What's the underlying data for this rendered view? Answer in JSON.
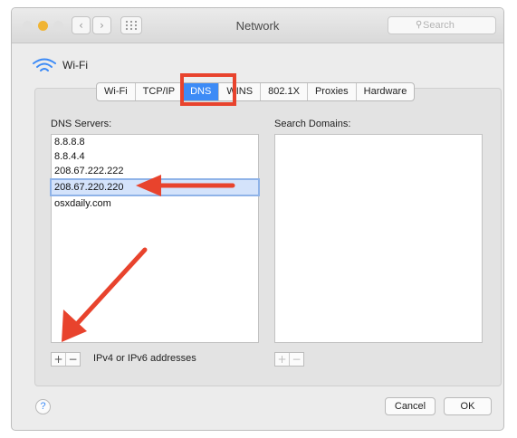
{
  "window": {
    "title": "Network",
    "search_placeholder": "Search",
    "traffic_lights": [
      "#e0e0e0",
      "#f0b434",
      "#e0e0e0"
    ]
  },
  "interface": {
    "name": "Wi-Fi",
    "icon": "wifi-icon"
  },
  "tabs": [
    {
      "label": "Wi-Fi",
      "active": false
    },
    {
      "label": "TCP/IP",
      "active": false
    },
    {
      "label": "DNS",
      "active": true
    },
    {
      "label": "WINS",
      "active": false
    },
    {
      "label": "802.1X",
      "active": false
    },
    {
      "label": "Proxies",
      "active": false
    },
    {
      "label": "Hardware",
      "active": false
    }
  ],
  "dns": {
    "label": "DNS Servers:",
    "servers": [
      "8.8.8.8",
      "8.8.4.4",
      "208.67.222.222",
      "208.67.220.220",
      "osxdaily.com"
    ],
    "editing_index": 3,
    "add_label": "+",
    "remove_label": "−",
    "hint": "IPv4 or IPv6 addresses"
  },
  "search_domains": {
    "label": "Search Domains:",
    "items": [],
    "add_label": "+",
    "remove_label": "−"
  },
  "footer": {
    "help_label": "?",
    "cancel_label": "Cancel",
    "ok_label": "OK"
  },
  "colors": {
    "accent": "#3d8bf6",
    "annotation": "#e8432d"
  }
}
